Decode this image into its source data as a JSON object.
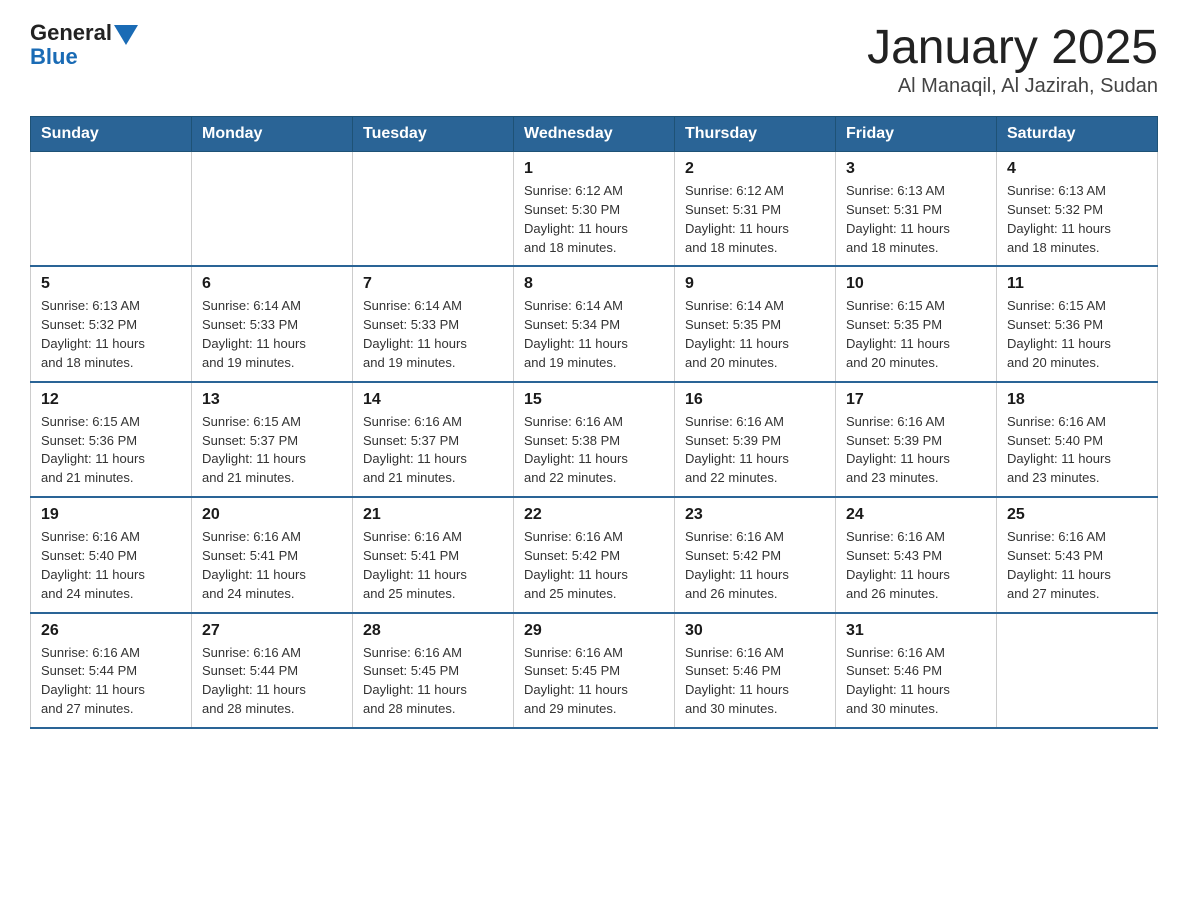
{
  "header": {
    "logo_general": "General",
    "logo_blue": "Blue",
    "title": "January 2025",
    "subtitle": "Al Manaqil, Al Jazirah, Sudan"
  },
  "weekdays": [
    "Sunday",
    "Monday",
    "Tuesday",
    "Wednesday",
    "Thursday",
    "Friday",
    "Saturday"
  ],
  "weeks": [
    [
      {
        "day": "",
        "info": ""
      },
      {
        "day": "",
        "info": ""
      },
      {
        "day": "",
        "info": ""
      },
      {
        "day": "1",
        "info": "Sunrise: 6:12 AM\nSunset: 5:30 PM\nDaylight: 11 hours\nand 18 minutes."
      },
      {
        "day": "2",
        "info": "Sunrise: 6:12 AM\nSunset: 5:31 PM\nDaylight: 11 hours\nand 18 minutes."
      },
      {
        "day": "3",
        "info": "Sunrise: 6:13 AM\nSunset: 5:31 PM\nDaylight: 11 hours\nand 18 minutes."
      },
      {
        "day": "4",
        "info": "Sunrise: 6:13 AM\nSunset: 5:32 PM\nDaylight: 11 hours\nand 18 minutes."
      }
    ],
    [
      {
        "day": "5",
        "info": "Sunrise: 6:13 AM\nSunset: 5:32 PM\nDaylight: 11 hours\nand 18 minutes."
      },
      {
        "day": "6",
        "info": "Sunrise: 6:14 AM\nSunset: 5:33 PM\nDaylight: 11 hours\nand 19 minutes."
      },
      {
        "day": "7",
        "info": "Sunrise: 6:14 AM\nSunset: 5:33 PM\nDaylight: 11 hours\nand 19 minutes."
      },
      {
        "day": "8",
        "info": "Sunrise: 6:14 AM\nSunset: 5:34 PM\nDaylight: 11 hours\nand 19 minutes."
      },
      {
        "day": "9",
        "info": "Sunrise: 6:14 AM\nSunset: 5:35 PM\nDaylight: 11 hours\nand 20 minutes."
      },
      {
        "day": "10",
        "info": "Sunrise: 6:15 AM\nSunset: 5:35 PM\nDaylight: 11 hours\nand 20 minutes."
      },
      {
        "day": "11",
        "info": "Sunrise: 6:15 AM\nSunset: 5:36 PM\nDaylight: 11 hours\nand 20 minutes."
      }
    ],
    [
      {
        "day": "12",
        "info": "Sunrise: 6:15 AM\nSunset: 5:36 PM\nDaylight: 11 hours\nand 21 minutes."
      },
      {
        "day": "13",
        "info": "Sunrise: 6:15 AM\nSunset: 5:37 PM\nDaylight: 11 hours\nand 21 minutes."
      },
      {
        "day": "14",
        "info": "Sunrise: 6:16 AM\nSunset: 5:37 PM\nDaylight: 11 hours\nand 21 minutes."
      },
      {
        "day": "15",
        "info": "Sunrise: 6:16 AM\nSunset: 5:38 PM\nDaylight: 11 hours\nand 22 minutes."
      },
      {
        "day": "16",
        "info": "Sunrise: 6:16 AM\nSunset: 5:39 PM\nDaylight: 11 hours\nand 22 minutes."
      },
      {
        "day": "17",
        "info": "Sunrise: 6:16 AM\nSunset: 5:39 PM\nDaylight: 11 hours\nand 23 minutes."
      },
      {
        "day": "18",
        "info": "Sunrise: 6:16 AM\nSunset: 5:40 PM\nDaylight: 11 hours\nand 23 minutes."
      }
    ],
    [
      {
        "day": "19",
        "info": "Sunrise: 6:16 AM\nSunset: 5:40 PM\nDaylight: 11 hours\nand 24 minutes."
      },
      {
        "day": "20",
        "info": "Sunrise: 6:16 AM\nSunset: 5:41 PM\nDaylight: 11 hours\nand 24 minutes."
      },
      {
        "day": "21",
        "info": "Sunrise: 6:16 AM\nSunset: 5:41 PM\nDaylight: 11 hours\nand 25 minutes."
      },
      {
        "day": "22",
        "info": "Sunrise: 6:16 AM\nSunset: 5:42 PM\nDaylight: 11 hours\nand 25 minutes."
      },
      {
        "day": "23",
        "info": "Sunrise: 6:16 AM\nSunset: 5:42 PM\nDaylight: 11 hours\nand 26 minutes."
      },
      {
        "day": "24",
        "info": "Sunrise: 6:16 AM\nSunset: 5:43 PM\nDaylight: 11 hours\nand 26 minutes."
      },
      {
        "day": "25",
        "info": "Sunrise: 6:16 AM\nSunset: 5:43 PM\nDaylight: 11 hours\nand 27 minutes."
      }
    ],
    [
      {
        "day": "26",
        "info": "Sunrise: 6:16 AM\nSunset: 5:44 PM\nDaylight: 11 hours\nand 27 minutes."
      },
      {
        "day": "27",
        "info": "Sunrise: 6:16 AM\nSunset: 5:44 PM\nDaylight: 11 hours\nand 28 minutes."
      },
      {
        "day": "28",
        "info": "Sunrise: 6:16 AM\nSunset: 5:45 PM\nDaylight: 11 hours\nand 28 minutes."
      },
      {
        "day": "29",
        "info": "Sunrise: 6:16 AM\nSunset: 5:45 PM\nDaylight: 11 hours\nand 29 minutes."
      },
      {
        "day": "30",
        "info": "Sunrise: 6:16 AM\nSunset: 5:46 PM\nDaylight: 11 hours\nand 30 minutes."
      },
      {
        "day": "31",
        "info": "Sunrise: 6:16 AM\nSunset: 5:46 PM\nDaylight: 11 hours\nand 30 minutes."
      },
      {
        "day": "",
        "info": ""
      }
    ]
  ]
}
